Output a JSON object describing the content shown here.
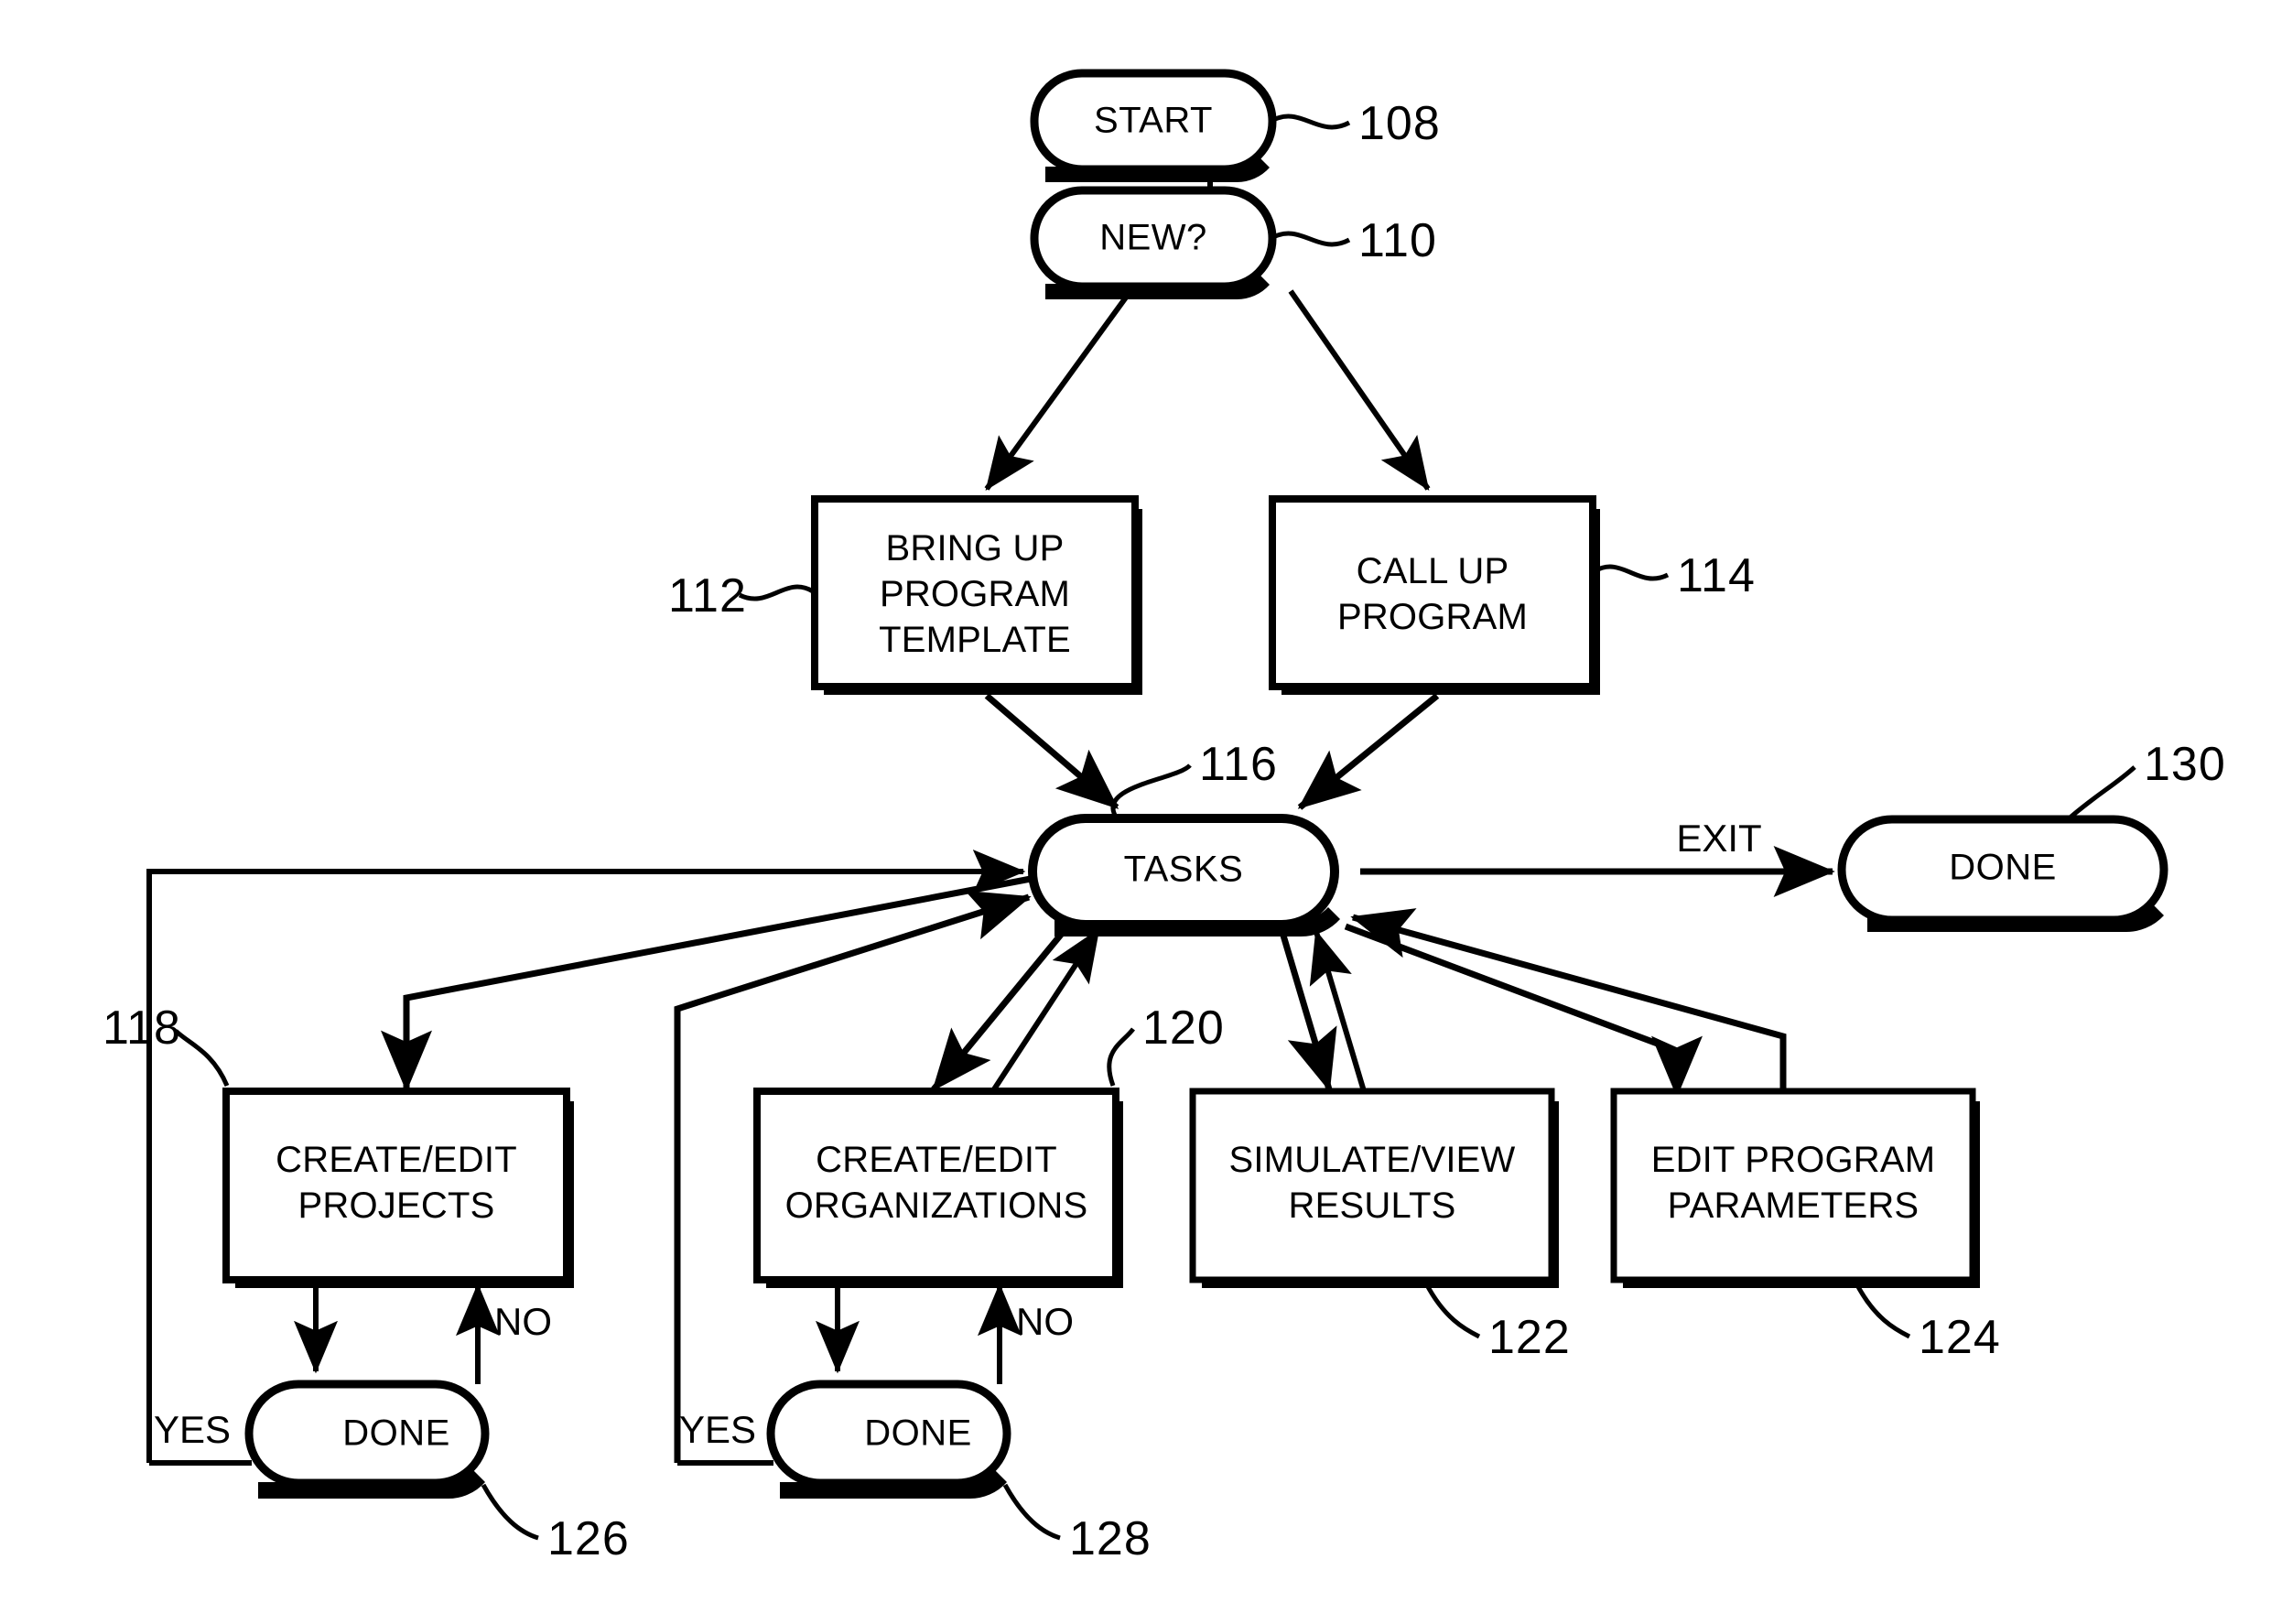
{
  "figure": {
    "type": "flowchart",
    "title": "",
    "background_color": "#ffffff",
    "line_color": "#000000"
  },
  "nodes": {
    "start": {
      "label": "START",
      "ref": "108",
      "shape": "stadium"
    },
    "new": {
      "label": "NEW?",
      "ref": "110",
      "shape": "stadium"
    },
    "bring_up": {
      "label_line1": "BRING UP",
      "label_line2": "PROGRAM",
      "label_line3": "TEMPLATE",
      "ref": "112",
      "shape": "rect"
    },
    "call_up": {
      "label_line1": "CALL UP",
      "label_line2": "PROGRAM",
      "ref": "114",
      "shape": "rect"
    },
    "tasks": {
      "label": "TASKS",
      "ref": "116",
      "shape": "stadium"
    },
    "done_exit": {
      "label": "DONE",
      "ref": "130",
      "shape": "stadium"
    },
    "create_projects": {
      "label_line1": "CREATE/EDIT",
      "label_line2": "PROJECTS",
      "ref": "118",
      "shape": "rect"
    },
    "create_orgs": {
      "label_line1": "CREATE/EDIT",
      "label_line2": "ORGANIZATIONS",
      "ref": "120",
      "shape": "rect"
    },
    "simulate_view": {
      "label_line1": "SIMULATE/VIEW",
      "label_line2": "RESULTS",
      "ref": "122",
      "shape": "rect"
    },
    "edit_params": {
      "label_line1": "EDIT PROGRAM",
      "label_line2": "PARAMETERS",
      "ref": "124",
      "shape": "rect"
    },
    "done_projects": {
      "label": "DONE",
      "ref": "126",
      "shape": "stadium"
    },
    "done_orgs": {
      "label": "DONE",
      "ref": "128",
      "shape": "stadium"
    }
  },
  "edge_labels": {
    "exit": "EXIT",
    "yes_projects": "YES",
    "no_projects": "NO",
    "yes_orgs": "YES",
    "no_orgs": "NO"
  },
  "ref_numbers": [
    "108",
    "110",
    "112",
    "114",
    "116",
    "118",
    "120",
    "122",
    "124",
    "126",
    "128",
    "130"
  ]
}
